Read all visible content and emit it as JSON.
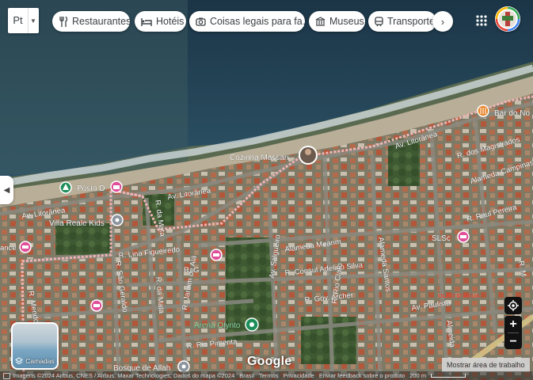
{
  "language": {
    "label": "Pt"
  },
  "chips": [
    {
      "label": "Restaurantes",
      "icon": "fork-knife-icon"
    },
    {
      "label": "Hotéis",
      "icon": "bed-icon"
    },
    {
      "label": "Coisas legais para fa…",
      "icon": "camera-icon"
    },
    {
      "label": "Museus",
      "icon": "museum-icon"
    },
    {
      "label": "Transporte p",
      "icon": "train-icon"
    }
  ],
  "streets": {
    "av_litoranea_1": "Av. Litorânea",
    "av_litoranea_2": "Av. Litorânea",
    "av_litoranea_3": "Av. Litorânea",
    "r_dos_magistrados": "R. dos Magistrados",
    "alameda_campinas": "Alameda Campinas",
    "r_raul_pereira": "R. Raul Pereira",
    "alameda_mearim": "Alameda Mearim",
    "r_consul_adelino_silva": "R. Consul Adelino Silva",
    "r_gov_archer": "R. Gov. Archer",
    "av_paulista": "Av. Paulista",
    "alameda_santos": "Alameda Santos",
    "r_rio_claro": "R. Rio Claro",
    "r_lina_figueiredo": "R. Lina Figueiredo",
    "r_sao_geraldo": "R. São Geraldo",
    "r_da_mata_1": "R. da Mata",
    "r_da_mata_2": "R. da Mata",
    "r_jardim_de_ala": "R. Jardim de Alá",
    "r_rio_pimenta": "R. Rio Pimenta",
    "r_do_meio": "R. Mendo",
    "av_salgueiro": "Av. Salgueiro",
    "almeida": "Almeida",
    "r_g": "R. G",
    "ance": "ance",
    "r_m": "R. M"
  },
  "places": {
    "cozinha_massari": "Cozinha Massari",
    "bar_do_no": "Bar do No",
    "posto": "Posto D",
    "villa_reale_kids": "Villa Reale Kids",
    "arena_olynto": "Arena Olynto",
    "bosque_de_allah": "Bosque de Allah",
    "sl_sc": "SLSc",
    "olho_dagua": "OLHO D'AGUA"
  },
  "layers": {
    "label": "Camadas"
  },
  "tooltip": "Mostrar área de trabalho",
  "logo": "Google",
  "footer": {
    "imagery": "Imagens ©2024 Airbus, CNES / Airbus, Maxar Technologies, Dados do mapa ©2024",
    "brasil": "Brasil",
    "terms": "Termos",
    "privacy": "Privacidade",
    "feedback": "Enviar feedback sobre o produto",
    "scale": "200 m"
  },
  "colors": {
    "ocean_deep": "#1e3a4f",
    "ocean_shallow": "#2f5468",
    "sand": "#b7aa92",
    "route": "#e8a3a3",
    "pin_pink": "#e0509a",
    "pin_green": "#1e8e5a",
    "pin_orange": "#e8852b",
    "pin_gray": "#8c959e"
  }
}
